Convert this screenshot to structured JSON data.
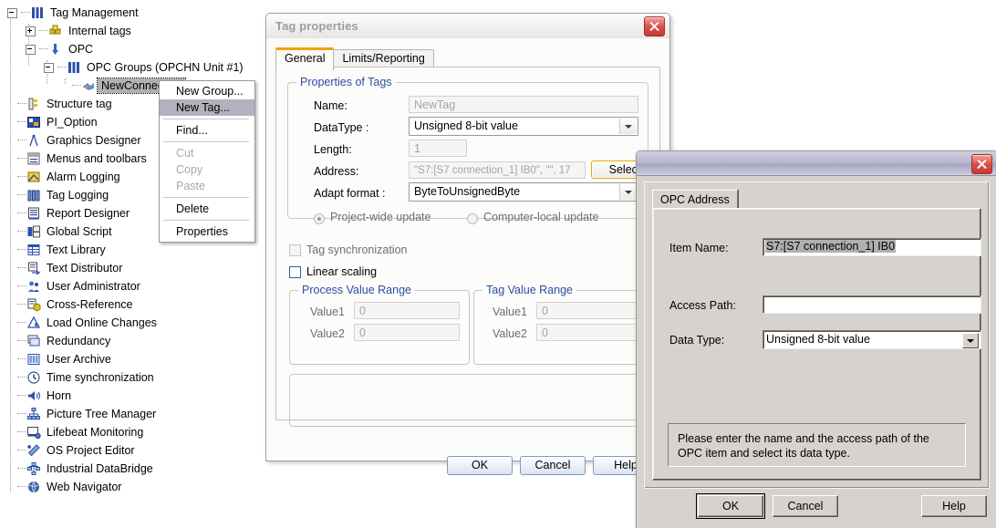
{
  "tree": {
    "nodes": [
      {
        "label": "Tag Management",
        "icon": "tag-management-icon",
        "indent": 0,
        "expander": "minus",
        "selected": false
      },
      {
        "label": "Internal tags",
        "icon": "internal-tags-icon",
        "indent": 1,
        "expander": "plus",
        "selected": false
      },
      {
        "label": "OPC",
        "icon": "opc-icon",
        "indent": 1,
        "expander": "minus",
        "selected": false
      },
      {
        "label": "OPC Groups (OPCHN Unit #1)",
        "icon": "opc-groups-icon",
        "indent": 2,
        "expander": "minus",
        "selected": false
      },
      {
        "label": "NewConnection",
        "icon": "connection-icon",
        "indent": 3,
        "expander": "none",
        "selected": true
      },
      {
        "label": "Structure tag",
        "icon": "structure-tag-icon",
        "indent": 0,
        "expander": "none",
        "selected": false
      },
      {
        "label": "PI_Option",
        "icon": "pi-option-icon",
        "indent": 0,
        "expander": "none",
        "selected": false
      },
      {
        "label": "Graphics Designer",
        "icon": "graphics-designer-icon",
        "indent": 0,
        "expander": "none",
        "selected": false
      },
      {
        "label": "Menus and toolbars",
        "icon": "menus-toolbars-icon",
        "indent": 0,
        "expander": "none",
        "selected": false
      },
      {
        "label": "Alarm Logging",
        "icon": "alarm-logging-icon",
        "indent": 0,
        "expander": "none",
        "selected": false
      },
      {
        "label": "Tag Logging",
        "icon": "tag-logging-icon",
        "indent": 0,
        "expander": "none",
        "selected": false
      },
      {
        "label": "Report Designer",
        "icon": "report-designer-icon",
        "indent": 0,
        "expander": "none",
        "selected": false
      },
      {
        "label": "Global Script",
        "icon": "global-script-icon",
        "indent": 0,
        "expander": "none",
        "selected": false
      },
      {
        "label": "Text Library",
        "icon": "text-library-icon",
        "indent": 0,
        "expander": "none",
        "selected": false
      },
      {
        "label": "Text Distributor",
        "icon": "text-distributor-icon",
        "indent": 0,
        "expander": "none",
        "selected": false
      },
      {
        "label": "User Administrator",
        "icon": "user-administrator-icon",
        "indent": 0,
        "expander": "none",
        "selected": false
      },
      {
        "label": "Cross-Reference",
        "icon": "cross-reference-icon",
        "indent": 0,
        "expander": "none",
        "selected": false
      },
      {
        "label": "Load Online Changes",
        "icon": "load-online-changes-icon",
        "indent": 0,
        "expander": "none",
        "selected": false
      },
      {
        "label": "Redundancy",
        "icon": "redundancy-icon",
        "indent": 0,
        "expander": "none",
        "selected": false
      },
      {
        "label": "User Archive",
        "icon": "user-archive-icon",
        "indent": 0,
        "expander": "none",
        "selected": false
      },
      {
        "label": "Time synchronization",
        "icon": "time-synchronization-icon",
        "indent": 0,
        "expander": "none",
        "selected": false
      },
      {
        "label": "Horn",
        "icon": "horn-icon",
        "indent": 0,
        "expander": "none",
        "selected": false
      },
      {
        "label": "Picture Tree Manager",
        "icon": "picture-tree-manager-icon",
        "indent": 0,
        "expander": "none",
        "selected": false
      },
      {
        "label": "Lifebeat Monitoring",
        "icon": "lifebeat-monitoring-icon",
        "indent": 0,
        "expander": "none",
        "selected": false
      },
      {
        "label": "OS Project Editor",
        "icon": "os-project-editor-icon",
        "indent": 0,
        "expander": "none",
        "selected": false
      },
      {
        "label": "Industrial DataBridge",
        "icon": "industrial-databridge-icon",
        "indent": 0,
        "expander": "none",
        "selected": false
      },
      {
        "label": "Web Navigator",
        "icon": "web-navigator-icon",
        "indent": 0,
        "expander": "none",
        "selected": false
      }
    ]
  },
  "context_menu": {
    "items": [
      {
        "label": "New Group...",
        "state": "normal"
      },
      {
        "label": "New Tag...",
        "state": "highlighted"
      },
      {
        "sep": true
      },
      {
        "label": "Find...",
        "state": "normal"
      },
      {
        "sep": true
      },
      {
        "label": "Cut",
        "state": "disabled"
      },
      {
        "label": "Copy",
        "state": "disabled"
      },
      {
        "label": "Paste",
        "state": "disabled"
      },
      {
        "sep": true
      },
      {
        "label": "Delete",
        "state": "normal"
      },
      {
        "sep": true
      },
      {
        "label": "Properties",
        "state": "normal"
      }
    ]
  },
  "tag_dialog": {
    "title": "Tag properties",
    "tabs": [
      {
        "label": "General",
        "active": true
      },
      {
        "label": "Limits/Reporting",
        "active": false
      }
    ],
    "properties_group": "Properties of Tags",
    "labels": {
      "name": "Name:",
      "datatype": "DataType :",
      "length": "Length:",
      "address": "Address:",
      "adapt_format": "Adapt format :"
    },
    "values": {
      "name": "NewTag",
      "datatype": "Unsigned 8-bit value",
      "length": "1",
      "address": "\"S7:[S7 connection_1] IB0\", \"\", 17",
      "adapt_format": "ByteToUnsignedByte"
    },
    "select_button": "Select",
    "radios": {
      "project_wide": "Project-wide update",
      "computer_local": "Computer-local update"
    },
    "checkboxes": {
      "tag_synchronization": "Tag synchronization",
      "linear_scaling": "Linear scaling"
    },
    "process_value_range": {
      "title": "Process Value Range",
      "value1_label": "Value1",
      "value1": "0",
      "value2_label": "Value2",
      "value2": "0"
    },
    "tag_value_range": {
      "title": "Tag Value Range",
      "value1_label": "Value1",
      "value1": "0",
      "value2_label": "Value2",
      "value2": "0"
    },
    "buttons": {
      "ok": "OK",
      "cancel": "Cancel",
      "help": "Help"
    },
    "accent_color": "#f0a30a"
  },
  "opc_dialog": {
    "title": "",
    "tab": "OPC Address",
    "labels": {
      "item_name": "Item Name:",
      "access_path": "Access Path:",
      "data_type": "Data Type:"
    },
    "values": {
      "item_name": "S7:[S7 connection_1] IB0",
      "access_path": "",
      "data_type": "Unsigned 8-bit value"
    },
    "info_text": "Please enter the name and the access path of the OPC item and select its data type.",
    "buttons": {
      "ok": "OK",
      "cancel": "Cancel",
      "help": "Help"
    }
  }
}
